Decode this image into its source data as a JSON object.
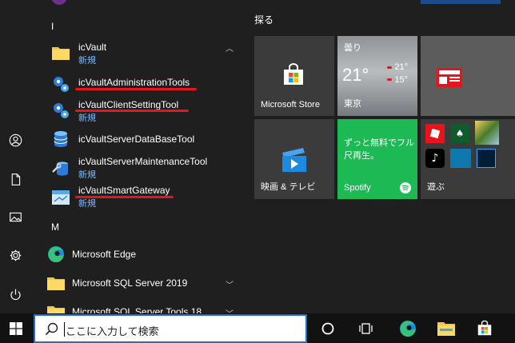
{
  "colors": {
    "accent_underline": "#e8131b",
    "sub_text": "#7ab8ff",
    "spotify_green": "#1db954",
    "search_border": "#1e6fd1"
  },
  "applist": {
    "letter_i": "I",
    "letter_m": "M",
    "apps": [
      {
        "name": "icVault",
        "sub": "新規",
        "icon": "folder-icon"
      },
      {
        "name": "icVaultAdministrationTools",
        "sub": "",
        "icon": "gears-icon"
      },
      {
        "name": "icVaultClientSettingTool",
        "sub": "新規",
        "icon": "gears-icon"
      },
      {
        "name": "icVaultServerDataBaseTool",
        "sub": "",
        "icon": "database-icon"
      },
      {
        "name": "icVaultServerMaintenanceTool",
        "sub": "新規",
        "icon": "maintenance-icon"
      },
      {
        "name": "icVaultSmartGateway",
        "sub": "新規",
        "icon": "gateway-icon"
      },
      {
        "name": "Microsoft Edge",
        "sub": "",
        "icon": "edge-icon"
      },
      {
        "name": "Microsoft SQL Server 2019",
        "sub": "",
        "icon": "folder-icon"
      },
      {
        "name": "Microsoft SQL Server Tools 18",
        "sub": "",
        "icon": "folder-icon"
      }
    ]
  },
  "tiles": {
    "section_title": "探る",
    "store_label": "Microsoft Store",
    "weather_condition": "曇り",
    "weather_temp": "21°",
    "weather_high": "21°",
    "weather_low": "15°",
    "weather_city": "東京",
    "movies_label": "映画 & テレビ",
    "spotify_text": "ずっと無料でフル尺再生。",
    "spotify_label": "Spotify",
    "play_label": "遊ぶ"
  },
  "taskbar": {
    "search_placeholder": "ここに入力して検索"
  }
}
